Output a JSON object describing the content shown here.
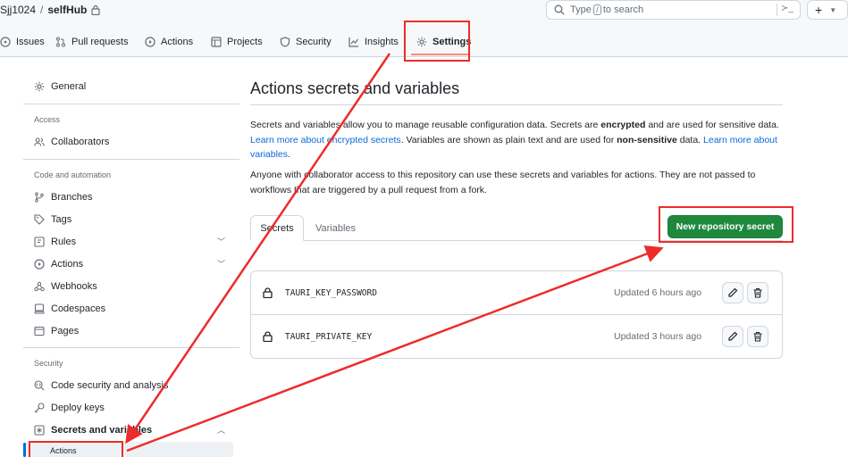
{
  "header": {
    "owner": "Sjj1024",
    "separator": "/",
    "repo": "selfHub",
    "search_prefix": "Type",
    "search_key": "/",
    "search_suffix": "to search",
    "terminal_glyph": "≻_",
    "plus": "+"
  },
  "tabs": [
    {
      "label": "Issues",
      "icon": "issue-icon"
    },
    {
      "label": "Pull requests",
      "icon": "pull-request-icon"
    },
    {
      "label": "Actions",
      "icon": "play-icon"
    },
    {
      "label": "Projects",
      "icon": "table-icon"
    },
    {
      "label": "Security",
      "icon": "shield-icon"
    },
    {
      "label": "Insights",
      "icon": "graph-icon"
    },
    {
      "label": "Settings",
      "icon": "gear-icon",
      "active": true
    }
  ],
  "sidebar": {
    "general": "General",
    "access_heading": "Access",
    "collaborators": "Collaborators",
    "code_heading": "Code and automation",
    "branches": "Branches",
    "tags": "Tags",
    "rules": "Rules",
    "actions": "Actions",
    "webhooks": "Webhooks",
    "codespaces": "Codespaces",
    "pages": "Pages",
    "security_heading": "Security",
    "code_security": "Code security and analysis",
    "deploy_keys": "Deploy keys",
    "secrets_variables": "Secrets and variables",
    "sub_actions": "Actions"
  },
  "main": {
    "title": "Actions secrets and variables",
    "p1_a": "Secrets and variables allow you to manage reusable configuration data. Secrets are ",
    "p1_b": "encrypted",
    "p1_c": " and are used for sensitive data. ",
    "p1_link1": "Learn more about encrypted secrets",
    "p1_d": ". Variables are shown as plain text and are used for ",
    "p1_e": "non-sensitive",
    "p1_f": " data. ",
    "p1_link2": "Learn more about variables",
    "p1_g": ".",
    "p2": "Anyone with collaborator access to this repository can use these secrets and variables for actions. They are not passed to workflows that are triggered by a pull request from a fork.",
    "tab_secrets": "Secrets",
    "tab_variables": "Variables",
    "new_secret": "New repository secret",
    "secrets": [
      {
        "name": "TAURI_KEY_PASSWORD",
        "updated": "Updated 6 hours ago"
      },
      {
        "name": "TAURI_PRIVATE_KEY",
        "updated": "Updated 3 hours ago"
      }
    ]
  },
  "colors": {
    "accent": "#0969da",
    "primary_button": "#1f883d",
    "annotation": "#ee2b2b",
    "tab_underline": "#fd8c73"
  }
}
